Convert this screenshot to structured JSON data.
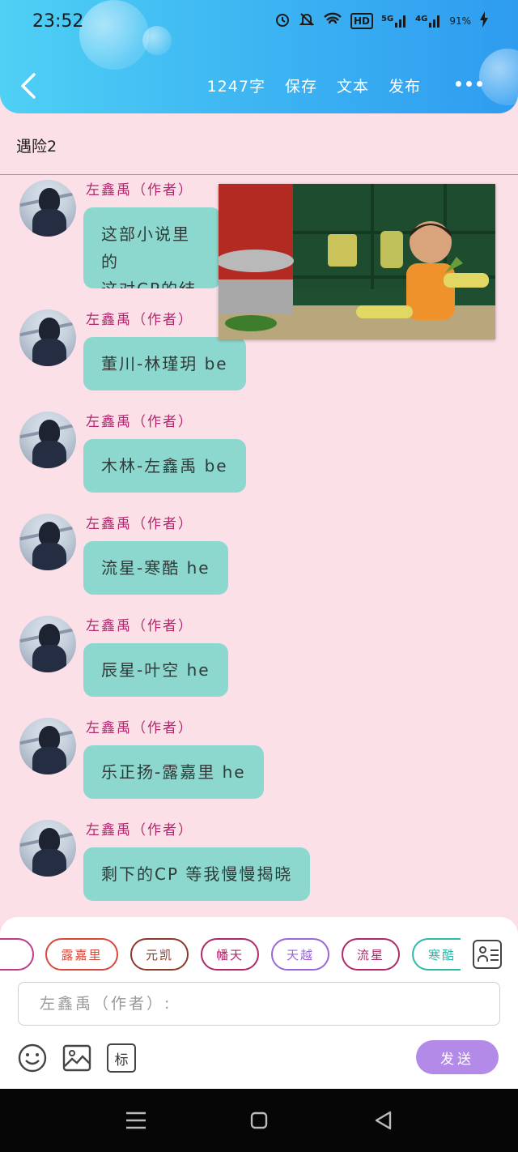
{
  "status_bar": {
    "time": "23:52",
    "battery": "91%",
    "network_labels": [
      "HD",
      "5G",
      "4G"
    ]
  },
  "header": {
    "word_count": "1247字",
    "save_label": "保存",
    "text_label": "文本",
    "publish_label": "发布"
  },
  "document": {
    "title": "遇险2"
  },
  "messages": [
    {
      "author": "左鑫禹（作者）",
      "text_line1": "这部小说里的",
      "text_line2": "这对CP的结局"
    },
    {
      "author": "左鑫禹（作者）",
      "text": "董川-林瑾玥 be"
    },
    {
      "author": "左鑫禹（作者）",
      "text": "木林-左鑫禹 be"
    },
    {
      "author": "左鑫禹（作者）",
      "text": "流星-寒酷 he"
    },
    {
      "author": "左鑫禹（作者）",
      "text": "辰星-叶空 he"
    },
    {
      "author": "左鑫禹（作者）",
      "text": "乐正扬-露嘉里 he"
    },
    {
      "author": "左鑫禹（作者）",
      "text": "剩下的CP 等我慢慢揭晓"
    }
  ],
  "character_chips": [
    {
      "label": "",
      "color": "#c23a8a"
    },
    {
      "label": "露嘉里",
      "color": "#d9483b"
    },
    {
      "label": "元凯",
      "color": "#8a3a2a"
    },
    {
      "label": "幡天",
      "color": "#b0286b"
    },
    {
      "label": "天越",
      "color": "#9a66d8"
    },
    {
      "label": "流星",
      "color": "#b0286b"
    },
    {
      "label": "寒酷",
      "color": "#2fb9a8"
    }
  ],
  "composer": {
    "placeholder": "左鑫禹（作者）:",
    "send_label": "发送",
    "tag_icon_label": "标"
  },
  "colors": {
    "header_gradient_start": "#4fd0f5",
    "header_gradient_end": "#2f9cf0",
    "background": "#fbe0e8",
    "bubble": "#8dd8ce",
    "author_name": "#b0286b",
    "send_button": "#b48ae8"
  }
}
